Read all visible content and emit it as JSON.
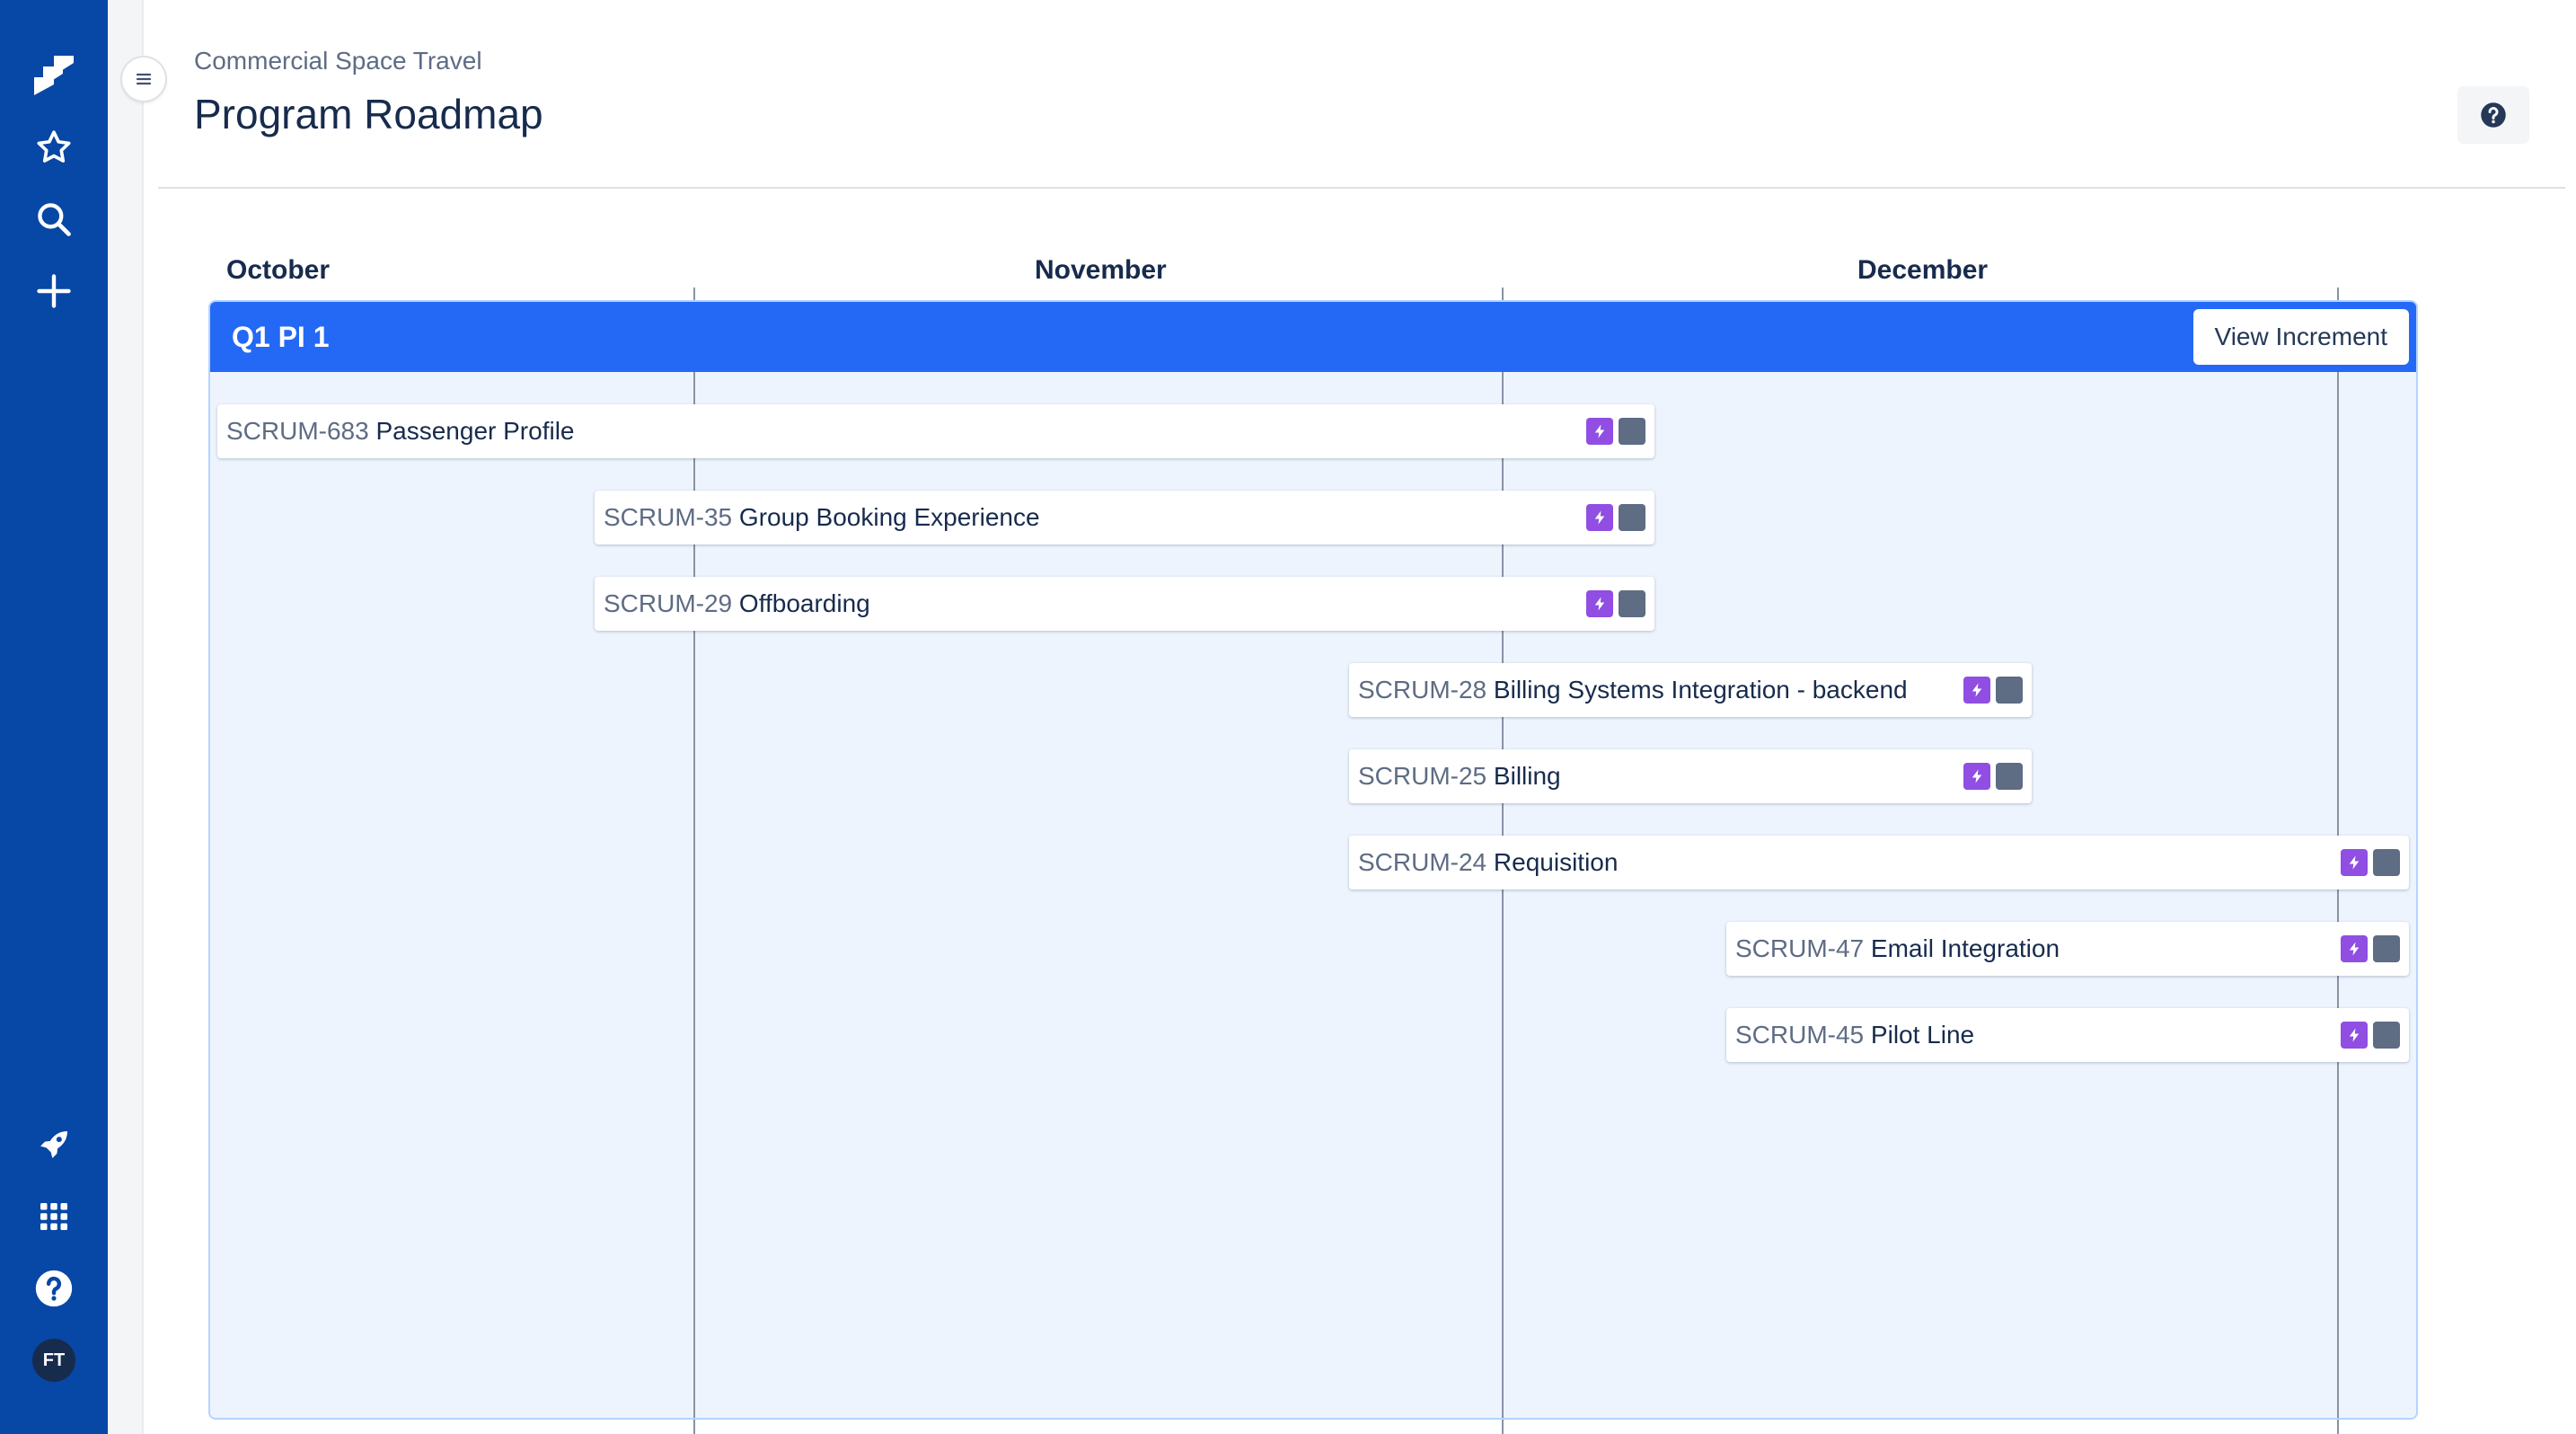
{
  "nav": {
    "icons": [
      "jira-logo-icon",
      "star-icon",
      "search-icon",
      "plus-icon",
      "rocket-icon",
      "app-switcher-icon",
      "help-icon"
    ],
    "avatar_initials": "FT",
    "color": "#0747a6"
  },
  "header": {
    "breadcrumb": "Commercial Space Travel",
    "title": "Program Roadmap"
  },
  "timeline": {
    "months": [
      "October",
      "November",
      "December"
    ],
    "increment": {
      "title": "Q1 PI 1",
      "view_button": "View Increment",
      "color": "#2469f5"
    },
    "items": [
      {
        "key": "SCRUM-683",
        "name": "Passenger Profile"
      },
      {
        "key": "SCRUM-35",
        "name": "Group Booking Experience"
      },
      {
        "key": "SCRUM-29",
        "name": "Offboarding"
      },
      {
        "key": "SCRUM-28",
        "name": "Billing Systems Integration - backend"
      },
      {
        "key": "SCRUM-25",
        "name": "Billing"
      },
      {
        "key": "SCRUM-24",
        "name": "Requisition"
      },
      {
        "key": "SCRUM-47",
        "name": "Email Integration"
      },
      {
        "key": "SCRUM-45",
        "name": "Pilot Line"
      }
    ],
    "epic_color": "#904ee2"
  }
}
